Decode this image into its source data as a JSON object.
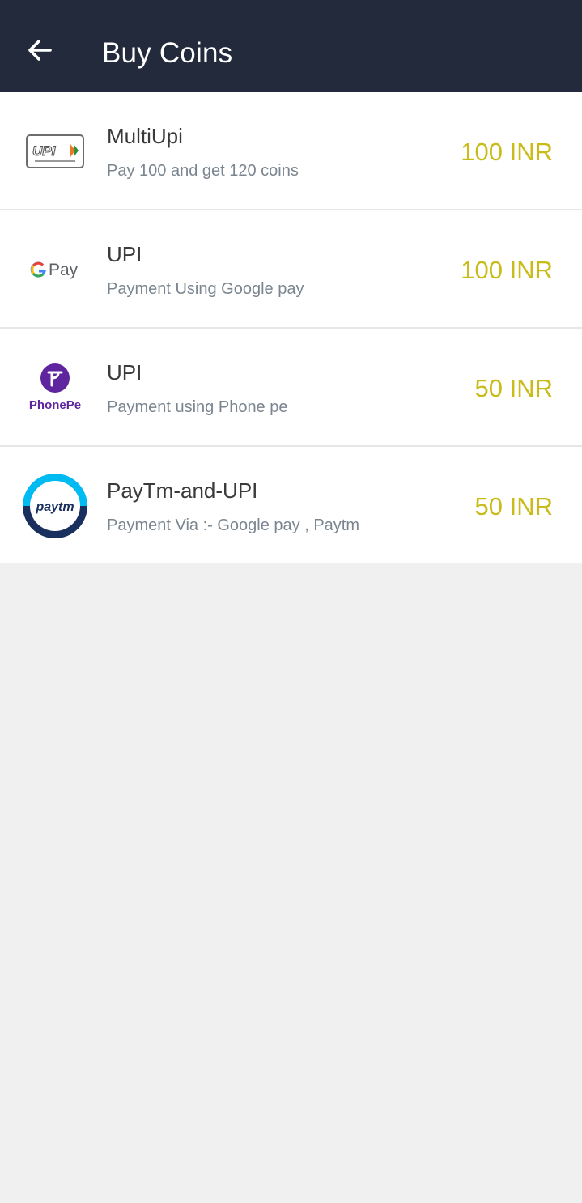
{
  "header": {
    "title": "Buy Coins",
    "back_icon": "arrow-left-icon",
    "background": "#222a3c"
  },
  "colors": {
    "price": "#c9bb18",
    "title_text": "#3a3a3a",
    "subtitle_text": "#7a8590",
    "page_background": "#f0f0f0"
  },
  "payment_options": [
    {
      "logo_icon": "upi-logo-icon",
      "logo_text": "UPI",
      "title": "MultiUpi",
      "subtitle": "Pay 100 and get 120 coins",
      "price": "100 INR"
    },
    {
      "logo_icon": "google-pay-logo-icon",
      "logo_text": "G Pay",
      "title": "UPI",
      "subtitle": "Payment Using Google pay",
      "price": "100 INR"
    },
    {
      "logo_icon": "phonepe-logo-icon",
      "logo_text": "PhonePe",
      "title": "UPI",
      "subtitle": "Payment using Phone pe",
      "price": "50 INR"
    },
    {
      "logo_icon": "paytm-logo-icon",
      "logo_text": "paytm",
      "title": "PayTm-and-UPI",
      "subtitle": "Payment Via :- Google pay , Paytm",
      "price": "50 INR"
    }
  ]
}
